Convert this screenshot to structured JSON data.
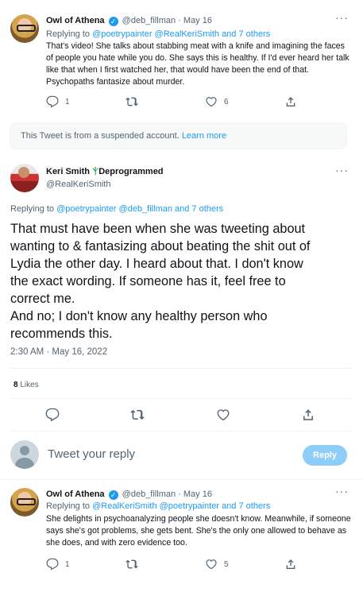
{
  "tweet1": {
    "name": "Owl of Athena",
    "handle": "@deb_fillman",
    "date": "· May 16",
    "replying_prefix": "Replying to",
    "replying_to": "@poetrypainter @RealKeriSmith and 7 others",
    "body": "That's video! She talks about stabbing meat with a knife and imagining the faces of people you hate while you do. She says this is healthy. If I'd ever heard her talk like that when I first watched her, that would have been the end of that. Psychopaths fantasize about murder.",
    "replies": "1",
    "retweets": "",
    "likes": "6"
  },
  "suspended": {
    "text": "This Tweet is from a suspended account.",
    "link": "Learn more"
  },
  "main": {
    "name": "Keri Smith",
    "name_suffix": "Deprogrammed",
    "handle": "@RealKeriSmith",
    "replying_prefix": "Replying to",
    "replying_to": "@poetrypainter @deb_fillman and 7 others",
    "body_lines": [
      "That must have been when she was tweeting about",
      "wanting to & fantasizing about beating the shit out of",
      "Lydia the other day. I heard about that. I don't know",
      "the exact wording. If someone has it, feel free to",
      "correct me.",
      "And no; I don't know any healthy person who",
      "recommends this."
    ],
    "timestamp": "2:30 AM · May 16, 2022",
    "likes_count": "8",
    "likes_label": "Likes"
  },
  "reply_box": {
    "placeholder": "Tweet your reply",
    "button": "Reply"
  },
  "tweet2": {
    "name": "Owl of Athena",
    "handle": "@deb_fillman",
    "date": "· May 16",
    "replying_prefix": "Replying to",
    "replying_to": "@RealKeriSmith @poetrypainter and 7 others",
    "body": "She delights in psychoanalyzing people she doesn't know. Meanwhile, if someone says she's got problems, she gets bent. She's the only one allowed to behave as she does, and with zero evidence too.",
    "replies": "1",
    "retweets": "",
    "likes": "5"
  },
  "icons": {
    "more": "more-icon",
    "reply": "reply-icon",
    "retweet": "retweet-icon",
    "like": "heart-icon",
    "share": "share-icon",
    "verified": "verified-badge-icon",
    "sprout": "sprout-icon"
  },
  "colors": {
    "accent": "#1d9bf0",
    "secondary_text": "#536471",
    "reply_button": "#8ecdf7"
  }
}
